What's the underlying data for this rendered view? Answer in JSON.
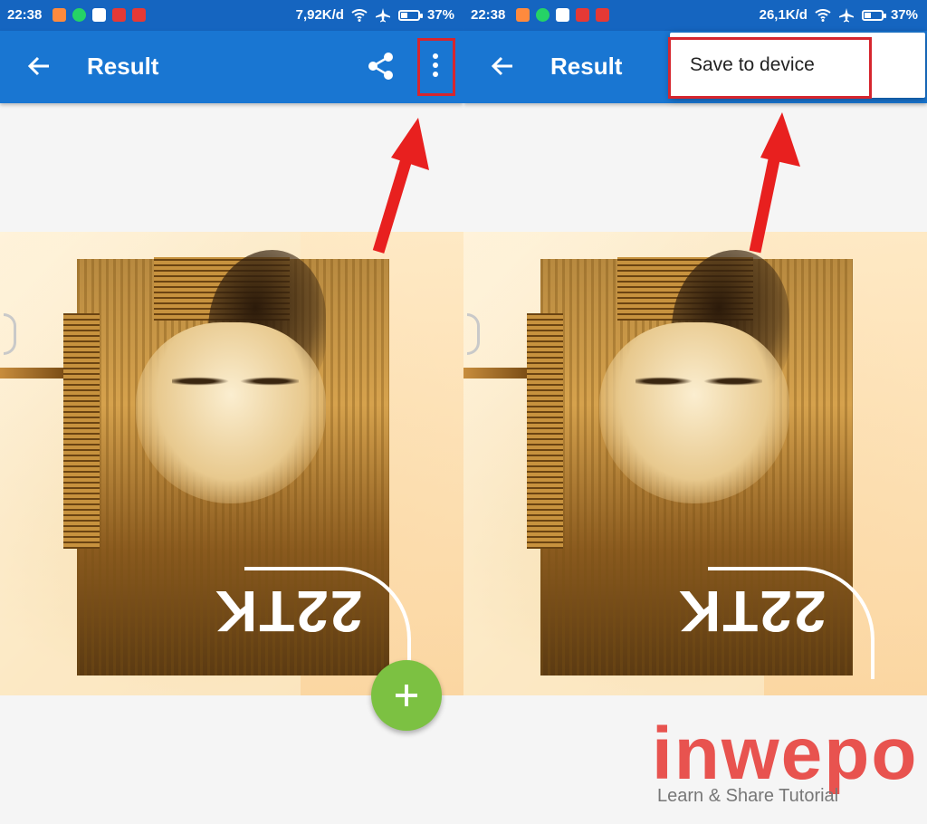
{
  "colors": {
    "status_bar": "#1565c0",
    "app_bar": "#1976d2",
    "fab": "#7cc142",
    "highlight": "#d6262e",
    "logo": "#e8534f"
  },
  "screens": [
    {
      "status": {
        "time": "22:38",
        "speed": "7,92K/d",
        "battery": "37%",
        "battery_level": 0.37
      },
      "appbar": {
        "title": "Result",
        "icons": [
          "arrow-back-icon",
          "share-icon",
          "more-vert-icon"
        ]
      }
    },
    {
      "status": {
        "time": "22:38",
        "speed": "26,1K/d",
        "battery": "37%",
        "battery_level": 0.37
      },
      "appbar": {
        "title": "Result",
        "icons": [
          "arrow-back-icon"
        ]
      },
      "menu": {
        "items": [
          "Save to device"
        ]
      }
    }
  ],
  "photo": {
    "shirt_text": "22TK"
  },
  "fab": {
    "icon": "plus-icon"
  },
  "watermark": {
    "name": "inwepo",
    "tagline": "Learn & Share Tutorial"
  }
}
